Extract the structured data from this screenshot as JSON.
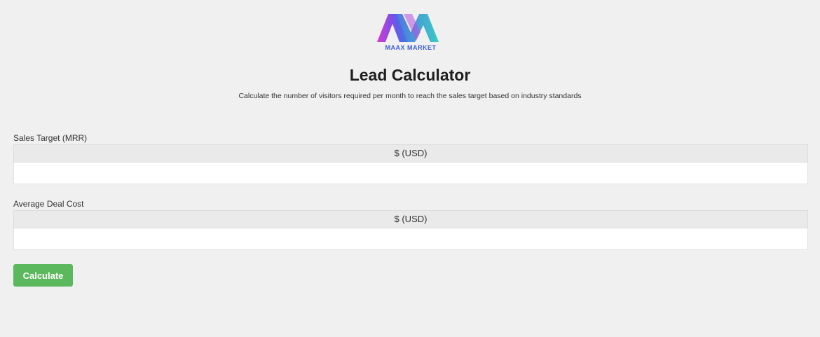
{
  "logo": {
    "text": "MAAX MARKET"
  },
  "header": {
    "title": "Lead Calculator",
    "subtitle": "Calculate the number of visitors required per month to reach the sales target based on industry standards"
  },
  "form": {
    "sales_target": {
      "label": "Sales Target (MRR)",
      "addon": "$ (USD)",
      "value": ""
    },
    "average_deal_cost": {
      "label": "Average Deal Cost",
      "addon": "$ (USD)",
      "value": ""
    },
    "calculate_label": "Calculate"
  },
  "colors": {
    "background": "#f0f0f0",
    "button": "#5cb85c",
    "logo_pink": "#e040c8",
    "logo_blue": "#3a6fe0",
    "logo_teal": "#2ec8c0"
  }
}
